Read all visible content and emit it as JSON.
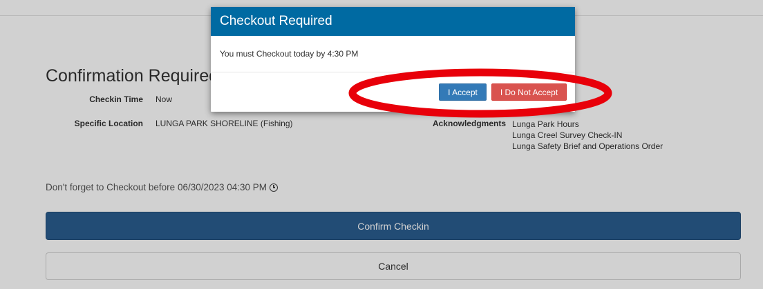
{
  "page": {
    "heading": "Confirmation Required",
    "checkin_time": {
      "label": "Checkin Time",
      "value": "Now"
    },
    "specific_location": {
      "label": "Specific Location",
      "value": "LUNGA PARK SHORELINE (Fishing)"
    },
    "acknowledgments": {
      "label": "Acknowledgments",
      "items": [
        "Lunga Park Hours",
        "Lunga Creel Survey Check-IN",
        "Lunga Safety Brief and Operations Order"
      ]
    },
    "reminder": "Don't forget to Checkout before 06/30/2023 04:30 PM",
    "reminder_icon": "clock-icon",
    "confirm_label": "Confirm Checkin",
    "cancel_label": "Cancel"
  },
  "modal": {
    "title": "Checkout Required",
    "message": "You must Checkout today by 4:30 PM",
    "accept_label": "I Accept",
    "decline_label": "I Do Not Accept"
  },
  "colors": {
    "modal_header": "#006aa2",
    "accept": "#337ab7",
    "decline": "#d9534f",
    "confirm": "#2a5d8f",
    "annotation": "#e8000a"
  }
}
